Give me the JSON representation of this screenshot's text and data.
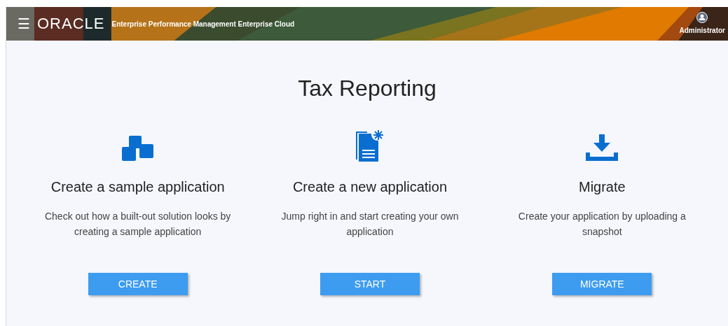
{
  "header": {
    "menu_icon": "☰",
    "logo": "ORACLE",
    "product": "Enterprise Performance Management Enterprise Cloud",
    "user": "Administrator"
  },
  "title": "Tax Reporting",
  "options": [
    {
      "kind": "sample",
      "title": "Create a sample application",
      "description": "Check out how a built-out solution looks by creating a sample application",
      "button": "CREATE"
    },
    {
      "kind": "new",
      "title": "Create a new application",
      "description": "Jump right in and start creating your own application",
      "button": "START"
    },
    {
      "kind": "migrate",
      "title": "Migrate",
      "description": "Create your application by uploading a snapshot",
      "button": "MIGRATE"
    }
  ]
}
